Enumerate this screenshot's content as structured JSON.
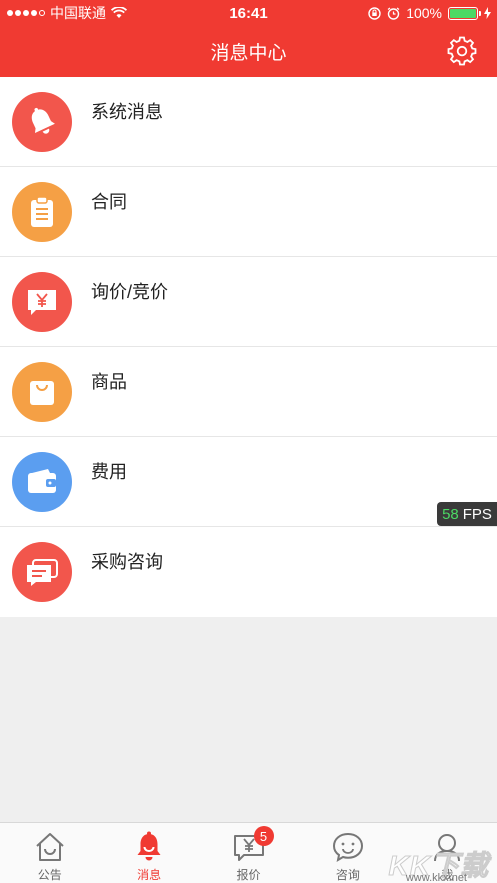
{
  "status_bar": {
    "carrier": "中国联通",
    "time": "16:41",
    "battery": "100%",
    "battery_level": 1.0
  },
  "header": {
    "title": "消息中心",
    "settings_icon": "gear-icon"
  },
  "colors": {
    "brand_red": "#f03a32",
    "coral": "#f2564c",
    "orange": "#f5a045",
    "blue": "#5b9ef0"
  },
  "list": {
    "items": [
      {
        "label": "系统消息",
        "icon": "bell-icon",
        "color": "#f2564c"
      },
      {
        "label": "合同",
        "icon": "clipboard-icon",
        "color": "#f5a045"
      },
      {
        "label": "询价/竞价",
        "icon": "yuan-chat-icon",
        "color": "#f2564c"
      },
      {
        "label": "商品",
        "icon": "shopping-bag-icon",
        "color": "#f5a045"
      },
      {
        "label": "费用",
        "icon": "wallet-icon",
        "color": "#5b9ef0"
      },
      {
        "label": "采购咨询",
        "icon": "messages-icon",
        "color": "#f2564c"
      }
    ]
  },
  "fps": {
    "value": "58",
    "unit": "FPS"
  },
  "tabs": [
    {
      "label": "公告",
      "icon": "home-icon",
      "active": false
    },
    {
      "label": "消息",
      "icon": "bell-icon",
      "active": true
    },
    {
      "label": "报价",
      "icon": "yuan-chat-icon",
      "active": false,
      "badge": "5"
    },
    {
      "label": "咨询",
      "icon": "smile-chat-icon",
      "active": false
    },
    {
      "label": "我",
      "icon": "user-icon",
      "active": false
    }
  ],
  "watermark": {
    "text": "KK下载",
    "url": "www.kkx.net"
  }
}
